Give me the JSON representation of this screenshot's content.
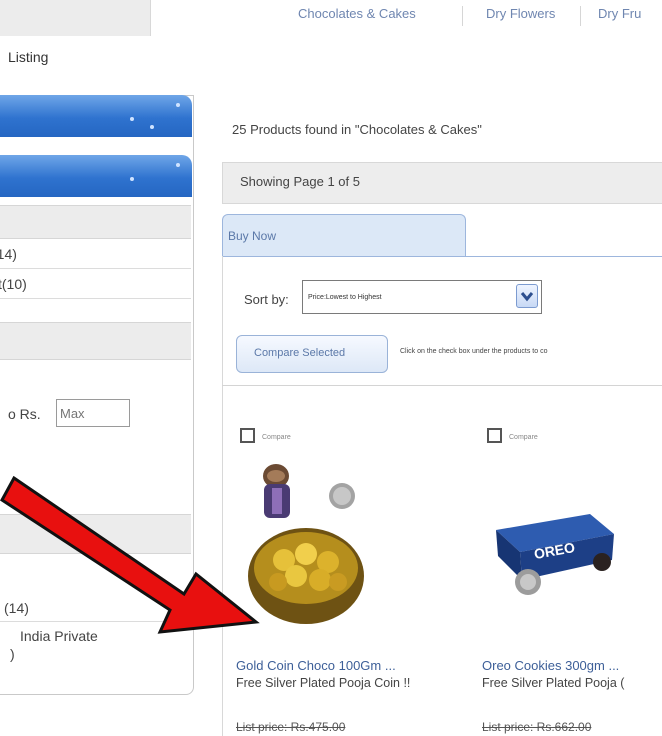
{
  "nav": {
    "items": [
      "Chocolates & Cakes",
      "Dry Flowers",
      "Dry Fru"
    ]
  },
  "page_heading": "Listing",
  "sidebar": {
    "brand_counts": [
      "(14)",
      "t(10)"
    ],
    "price_to_label": "o Rs.",
    "price_max_placeholder": "Max",
    "seller_count": "(14)",
    "seller_name": "India Private",
    "seller_extra": ")"
  },
  "results": {
    "found_text": "25 Products found in \"Chocolates & Cakes\"",
    "showing_text": "Showing Page 1 of 5",
    "tab_label": "Buy Now",
    "sort_label": "Sort by:",
    "sort_value": "Price:Lowest to Highest",
    "compare_button": "Compare Selected",
    "compare_hint": "Click on the check box under the products to co"
  },
  "products": [
    {
      "compare_label": "Compare",
      "name": "Gold Coin Choco 100Gm ...",
      "desc": "Free Silver Plated Pooja Coin !!",
      "price": "List price: Rs.475.00"
    },
    {
      "compare_label": "Compare",
      "name": "Oreo Cookies 300gm ...",
      "desc": "Free Silver Plated Pooja (",
      "price": "List price: Rs.662.00"
    }
  ],
  "colors": {
    "accent_blue": "#2f73cf",
    "link_blue": "#3d5f98",
    "arrow_red": "#e8100f"
  },
  "icons": {
    "dropdown": "chevron-down-icon",
    "annotation": "red-arrow-icon"
  }
}
